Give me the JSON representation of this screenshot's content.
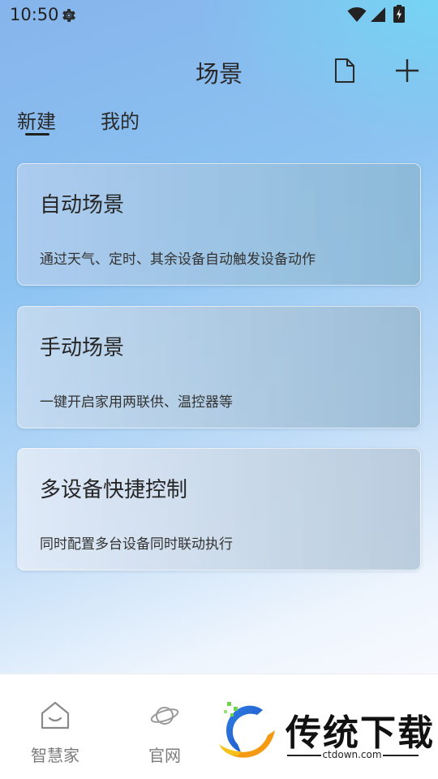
{
  "status_bar": {
    "time": "10:50",
    "icons": [
      "gear-icon",
      "wifi-icon",
      "signal-icon",
      "battery-icon"
    ]
  },
  "header": {
    "title": "场景",
    "actions": [
      "document-icon",
      "add-icon"
    ]
  },
  "tabs": [
    {
      "label": "新建",
      "active": true
    },
    {
      "label": "我的",
      "active": false
    }
  ],
  "cards": [
    {
      "title": "自动场景",
      "description": "通过天气、定时、其余设备自动触发设备动作"
    },
    {
      "title": "手动场景",
      "description": "一键开启家用两联供、温控器等"
    },
    {
      "title": "多设备快捷控制",
      "description": "同时配置多台设备同时联动执行"
    }
  ],
  "bottom_nav": [
    {
      "label": "智慧家",
      "icon": "home-icon"
    },
    {
      "label": "官网",
      "icon": "planet-icon"
    }
  ],
  "watermark": {
    "text": "传统下载",
    "url": "ctdown.com"
  },
  "colors": {
    "gradient_top": "#86b4ec",
    "gradient_accent": "#6edcf5",
    "gradient_bottom": "#f7fafe",
    "text_primary": "#262626",
    "nav_label": "#7c7c7c"
  }
}
